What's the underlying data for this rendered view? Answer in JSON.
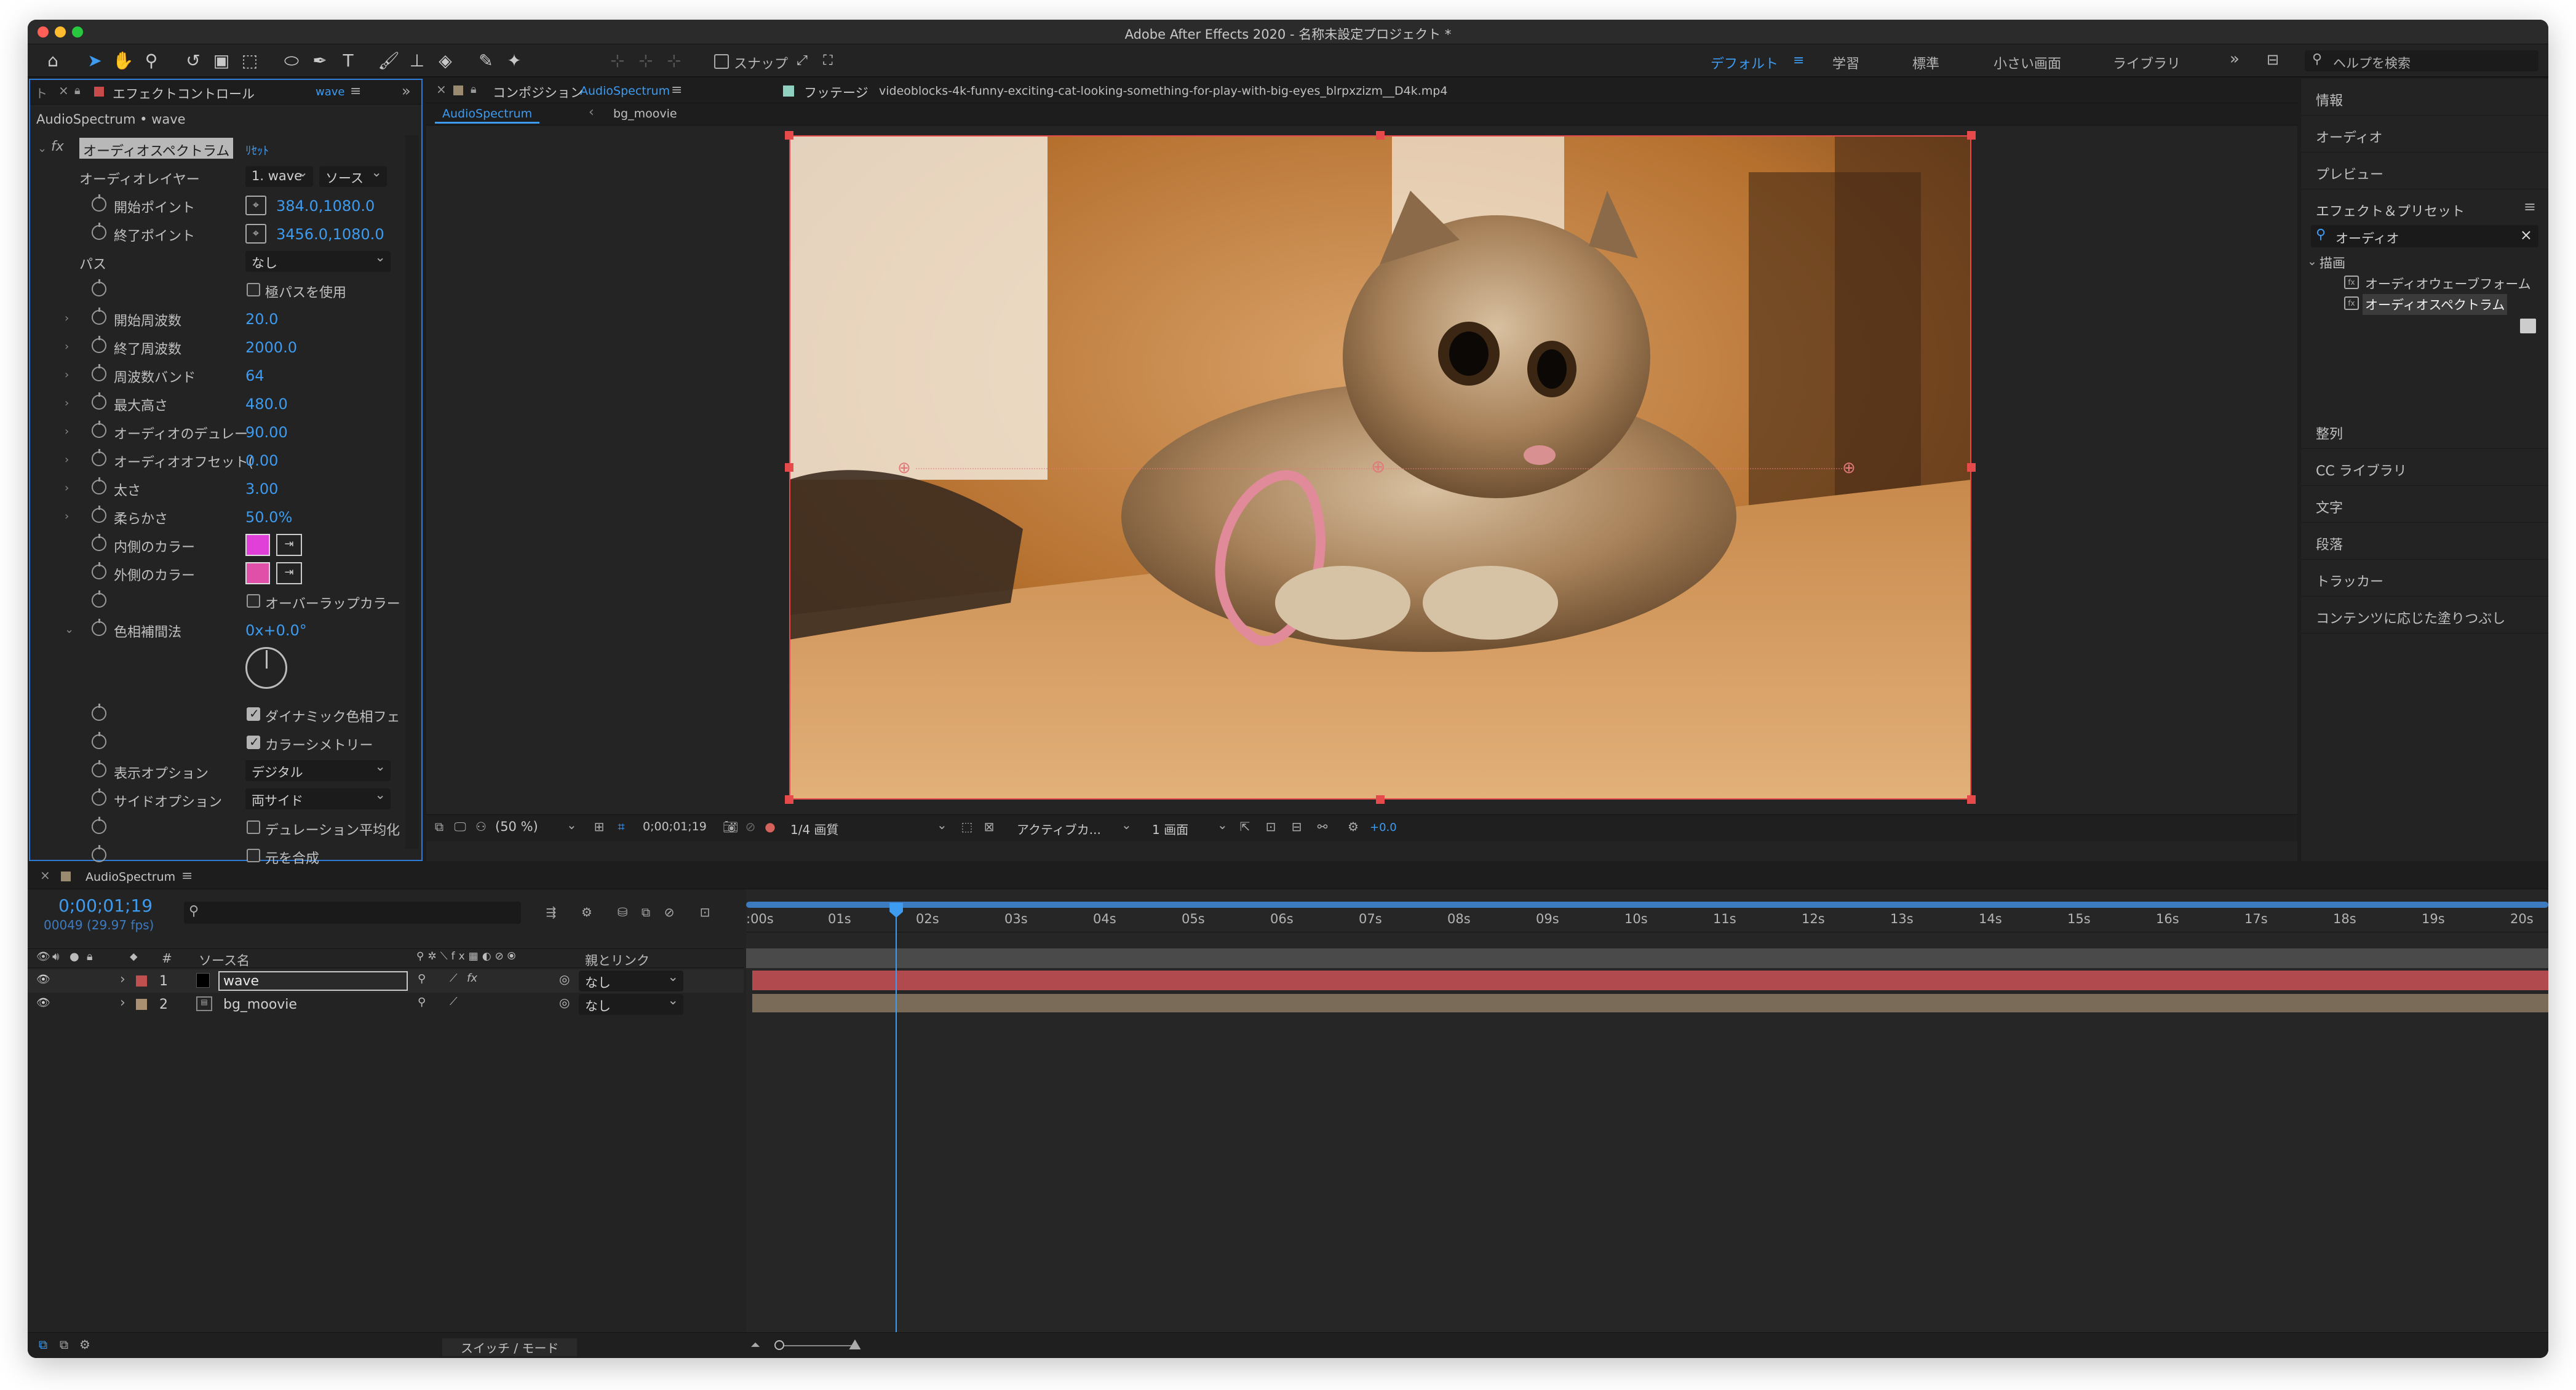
{
  "window": {
    "title": "Adobe After Effects 2020 - 名称未設定プロジェクト *"
  },
  "toolbar": {
    "snap_label": "スナップ",
    "workspaces": [
      "デフォルト",
      "学習",
      "標準",
      "小さい画面",
      "ライブラリ"
    ],
    "more_label": "»",
    "help_placeholder": "ヘルプを検索"
  },
  "effect_controls": {
    "tab_title": "エフェクトコントロール",
    "tab_layer": "wave",
    "breadcrumb": "AudioSpectrum • wave",
    "effect_name": "オーディオスペクトラム",
    "reset_label": "ﾘｾｯﾄ",
    "audio_layer_label": "オーディオレイヤー",
    "audio_layer_value": "1. wave",
    "audio_layer_source": "ソース",
    "start_point_label": "開始ポイント",
    "start_point_value": "384.0,1080.0",
    "end_point_label": "終了ポイント",
    "end_point_value": "3456.0,1080.0",
    "path_label": "パス",
    "path_value": "なし",
    "polar_path_label": "極パスを使用",
    "params": [
      {
        "label": "開始周波数",
        "value": "20.0"
      },
      {
        "label": "終了周波数",
        "value": "2000.0"
      },
      {
        "label": "周波数バンド",
        "value": "64"
      },
      {
        "label": "最大高さ",
        "value": "480.0"
      },
      {
        "label": "オーディオのデュレー",
        "value": "90.00"
      },
      {
        "label": "オーディオオフセット(",
        "value": "0.00"
      },
      {
        "label": "太さ",
        "value": "3.00"
      },
      {
        "label": "柔らかさ",
        "value": "50.0%"
      }
    ],
    "inside_color_label": "内側のカラー",
    "inside_color": "#e040d8",
    "outside_color_label": "外側のカラー",
    "outside_color": "#e050a8",
    "overlap_color_label": "オーバーラップカラー",
    "hue_interp_label": "色相補間法",
    "hue_interp_value": "0x+0.0°",
    "dynamic_hue_label": "ダイナミック色相フェ",
    "color_symmetry_label": "カラーシメトリー",
    "display_options_label": "表示オプション",
    "display_options_value": "デジタル",
    "side_options_label": "サイドオプション",
    "side_options_value": "両サイド",
    "duration_avg_label": "デュレーション平均化",
    "composite_label": "元を合成"
  },
  "composition": {
    "tab_prefix": "コンポジション",
    "tab_name": "AudioSpectrum",
    "footage_prefix": "フッテージ",
    "footage_name": "videoblocks-4k-funny-exciting-cat-looking-something-for-play-with-big-eyes_blrpxzizm__D4k.mp4",
    "crumb_1": "AudioSpectrum",
    "crumb_2": "bg_moovie",
    "zoom": "(50 %)",
    "timecode": "0;00;01;19",
    "resolution": "1/4 画質",
    "camera": "アクティブカ...",
    "views": "1 画面",
    "exposure": "+0.0"
  },
  "right_panel": {
    "items_top": [
      "情報",
      "オーディオ",
      "プレビュー"
    ],
    "effects_presets_title": "エフェクト＆プリセット",
    "search_value": "オーディオ",
    "category": "描画",
    "results": [
      "オーディオウェーブフォーム",
      "オーディオスペクトラム"
    ],
    "items_bottom": [
      "整列",
      "CC ライブラリ",
      "文字",
      "段落",
      "トラッカー",
      "コンテンツに応じた塗りつぶし"
    ]
  },
  "timeline": {
    "tab_name": "AudioSpectrum",
    "timecode": "0;00;01;19",
    "frame_info": "00049 (29.97 fps)",
    "col_num": "#",
    "col_source": "ソース名",
    "col_parent": "親とリンク",
    "layers": [
      {
        "num": "1",
        "name": "wave",
        "parent": "なし",
        "label_color": "#c05050"
      },
      {
        "num": "2",
        "name": "bg_moovie",
        "parent": "なし",
        "label_color": "#a89070"
      }
    ],
    "ruler": [
      ":00s",
      "01s",
      "02s",
      "03s",
      "04s",
      "05s",
      "06s",
      "07s",
      "08s",
      "09s",
      "10s",
      "11s",
      "12s",
      "13s",
      "14s",
      "15s",
      "16s",
      "17s",
      "18s",
      "19s",
      "20s"
    ],
    "playhead_seconds": 1.63,
    "duration_seconds": 20,
    "switches_modes": "スイッチ / モード"
  }
}
